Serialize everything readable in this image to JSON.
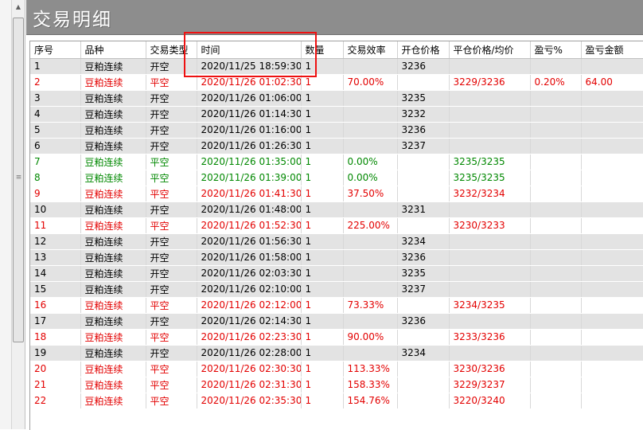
{
  "title": "交易明细",
  "columns": [
    "序号",
    "品种",
    "交易类型",
    "时间",
    "数量",
    "交易效率",
    "开仓价格",
    "平仓价格/均价",
    "盈亏%",
    "盈亏金额"
  ],
  "rows": [
    {
      "style": "gray",
      "cells": [
        "1",
        "豆粕连续",
        "开空",
        "2020/11/25 18:59:30",
        "1",
        "",
        "3236",
        "",
        "",
        ""
      ]
    },
    {
      "style": "red",
      "cells": [
        "2",
        "豆粕连续",
        "平空",
        "2020/11/26 01:02:30",
        "1",
        "70.00%",
        "",
        "3229/3236",
        "0.20%",
        "64.00"
      ]
    },
    {
      "style": "gray",
      "cells": [
        "3",
        "豆粕连续",
        "开空",
        "2020/11/26 01:06:00",
        "1",
        "",
        "3235",
        "",
        "",
        ""
      ]
    },
    {
      "style": "gray",
      "cells": [
        "4",
        "豆粕连续",
        "开空",
        "2020/11/26 01:14:30",
        "1",
        "",
        "3232",
        "",
        "",
        ""
      ]
    },
    {
      "style": "gray",
      "cells": [
        "5",
        "豆粕连续",
        "开空",
        "2020/11/26 01:16:00",
        "1",
        "",
        "3236",
        "",
        "",
        ""
      ]
    },
    {
      "style": "gray",
      "cells": [
        "6",
        "豆粕连续",
        "开空",
        "2020/11/26 01:26:30",
        "1",
        "",
        "3237",
        "",
        "",
        ""
      ]
    },
    {
      "style": "green",
      "cells": [
        "7",
        "豆粕连续",
        "平空",
        "2020/11/26 01:35:00",
        "1",
        "0.00%",
        "",
        "3235/3235",
        "",
        ""
      ]
    },
    {
      "style": "green",
      "cells": [
        "8",
        "豆粕连续",
        "平空",
        "2020/11/26 01:39:00",
        "1",
        "0.00%",
        "",
        "3235/3235",
        "",
        ""
      ]
    },
    {
      "style": "red",
      "cells": [
        "9",
        "豆粕连续",
        "平空",
        "2020/11/26 01:41:30",
        "1",
        "37.50%",
        "",
        "3232/3234",
        "",
        ""
      ]
    },
    {
      "style": "gray",
      "cells": [
        "10",
        "豆粕连续",
        "开空",
        "2020/11/26 01:48:00",
        "1",
        "",
        "3231",
        "",
        "",
        ""
      ]
    },
    {
      "style": "red",
      "cells": [
        "11",
        "豆粕连续",
        "平空",
        "2020/11/26 01:52:30",
        "1",
        "225.00%",
        "",
        "3230/3233",
        "",
        ""
      ]
    },
    {
      "style": "gray",
      "cells": [
        "12",
        "豆粕连续",
        "开空",
        "2020/11/26 01:56:30",
        "1",
        "",
        "3234",
        "",
        "",
        ""
      ]
    },
    {
      "style": "gray",
      "cells": [
        "13",
        "豆粕连续",
        "开空",
        "2020/11/26 01:58:00",
        "1",
        "",
        "3236",
        "",
        "",
        ""
      ]
    },
    {
      "style": "gray",
      "cells": [
        "14",
        "豆粕连续",
        "开空",
        "2020/11/26 02:03:30",
        "1",
        "",
        "3235",
        "",
        "",
        ""
      ]
    },
    {
      "style": "gray",
      "cells": [
        "15",
        "豆粕连续",
        "开空",
        "2020/11/26 02:10:00",
        "1",
        "",
        "3237",
        "",
        "",
        ""
      ]
    },
    {
      "style": "red",
      "cells": [
        "16",
        "豆粕连续",
        "平空",
        "2020/11/26 02:12:00",
        "1",
        "73.33%",
        "",
        "3234/3235",
        "",
        ""
      ]
    },
    {
      "style": "gray",
      "cells": [
        "17",
        "豆粕连续",
        "开空",
        "2020/11/26 02:14:30",
        "1",
        "",
        "3236",
        "",
        "",
        ""
      ]
    },
    {
      "style": "red",
      "cells": [
        "18",
        "豆粕连续",
        "平空",
        "2020/11/26 02:23:30",
        "1",
        "90.00%",
        "",
        "3233/3236",
        "",
        ""
      ]
    },
    {
      "style": "gray",
      "cells": [
        "19",
        "豆粕连续",
        "开空",
        "2020/11/26 02:28:00",
        "1",
        "",
        "3234",
        "",
        "",
        ""
      ]
    },
    {
      "style": "red",
      "cells": [
        "20",
        "豆粕连续",
        "平空",
        "2020/11/26 02:30:30",
        "1",
        "113.33%",
        "",
        "3230/3236",
        "",
        ""
      ]
    },
    {
      "style": "red",
      "cells": [
        "21",
        "豆粕连续",
        "平空",
        "2020/11/26 02:31:30",
        "1",
        "158.33%",
        "",
        "3229/3237",
        "",
        ""
      ]
    },
    {
      "style": "red",
      "cells": [
        "22",
        "豆粕连续",
        "平空",
        "2020/11/26 02:35:30",
        "1",
        "154.76%",
        "",
        "3220/3240",
        "",
        ""
      ]
    }
  ],
  "colors": {
    "row_gray": "#e3e3e3",
    "text_red": "#e30000",
    "text_green": "#008800",
    "annotation_box": "#ee1111",
    "title_bar": "#8d8d8d"
  },
  "icons": {
    "scroll_up": "arrow-up",
    "scroll_down": "arrow-down",
    "grip": "scroll-grip"
  }
}
